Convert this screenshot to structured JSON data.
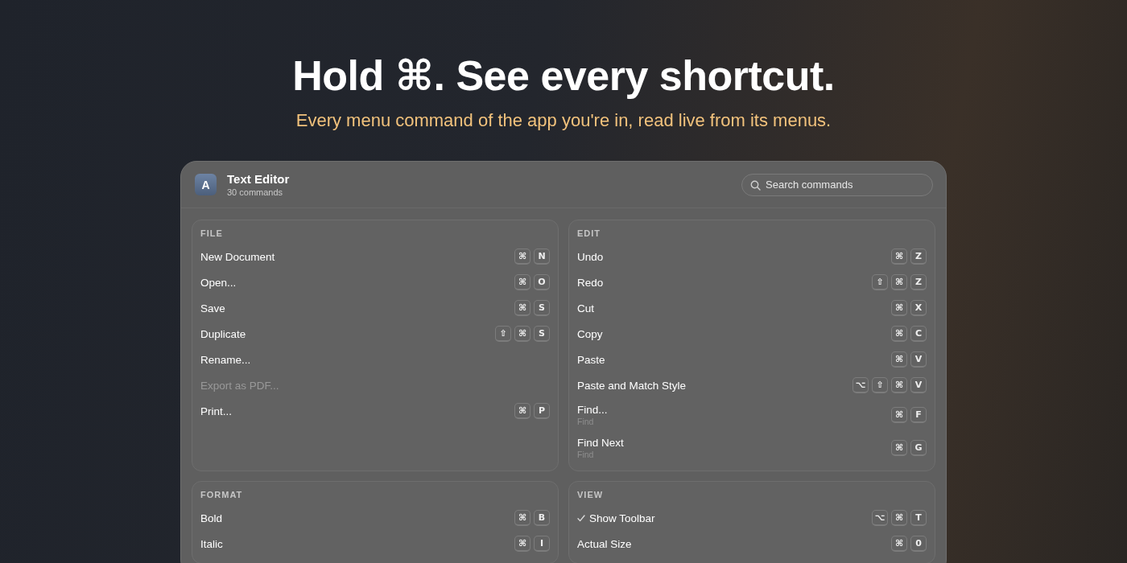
{
  "hero": {
    "title": "Hold ⌘. See every shortcut.",
    "subtitle": "Every menu command of the app you're in, read live from its menus."
  },
  "panel": {
    "app_icon_letter": "A",
    "app_name": "Text Editor",
    "command_count": "30 commands",
    "search": {
      "placeholder": "Search commands"
    },
    "sections": [
      {
        "title": "FILE",
        "items": [
          {
            "label": "New Document",
            "keys": [
              "⌘",
              "N"
            ],
            "disabled": false
          },
          {
            "label": "Open...",
            "keys": [
              "⌘",
              "O"
            ],
            "disabled": false
          },
          {
            "label": "Save",
            "keys": [
              "⌘",
              "S"
            ],
            "disabled": false
          },
          {
            "label": "Duplicate",
            "keys": [
              "⇧",
              "⌘",
              "S"
            ],
            "disabled": false
          },
          {
            "label": "Rename...",
            "disabled": false
          },
          {
            "label": "Export as PDF...",
            "disabled": true
          },
          {
            "label": "Print...",
            "keys": [
              "⌘",
              "P"
            ],
            "disabled": false
          }
        ]
      },
      {
        "title": "EDIT",
        "items": [
          {
            "label": "Undo",
            "keys": [
              "⌘",
              "Z"
            ],
            "disabled": false
          },
          {
            "label": "Redo",
            "keys": [
              "⇧",
              "⌘",
              "Z"
            ],
            "disabled": false
          },
          {
            "label": "Cut",
            "keys": [
              "⌘",
              "X"
            ],
            "disabled": false
          },
          {
            "label": "Copy",
            "keys": [
              "⌘",
              "C"
            ],
            "disabled": false
          },
          {
            "label": "Paste",
            "keys": [
              "⌘",
              "V"
            ],
            "disabled": false
          },
          {
            "label": "Paste and Match Style",
            "keys": [
              "⌥",
              "⇧",
              "⌘",
              "V"
            ],
            "disabled": false
          },
          {
            "label": "Find...",
            "subtitle": "Find",
            "keys": [
              "⌘",
              "F"
            ],
            "disabled": false
          },
          {
            "label": "Find Next",
            "subtitle": "Find",
            "keys": [
              "⌘",
              "G"
            ],
            "disabled": false
          }
        ]
      },
      {
        "title": "FORMAT",
        "items": [
          {
            "label": "Bold",
            "keys": [
              "⌘",
              "B"
            ],
            "disabled": false
          },
          {
            "label": "Italic",
            "keys": [
              "⌘",
              "I"
            ],
            "disabled": false
          }
        ]
      },
      {
        "title": "VIEW",
        "items": [
          {
            "label": "Show Toolbar",
            "keys": [
              "⌥",
              "⌘",
              "T"
            ],
            "disabled": false,
            "checked": true
          },
          {
            "label": "Actual Size",
            "keys": [
              "⌘",
              "0"
            ],
            "disabled": false,
            "checked": false
          }
        ]
      }
    ]
  }
}
